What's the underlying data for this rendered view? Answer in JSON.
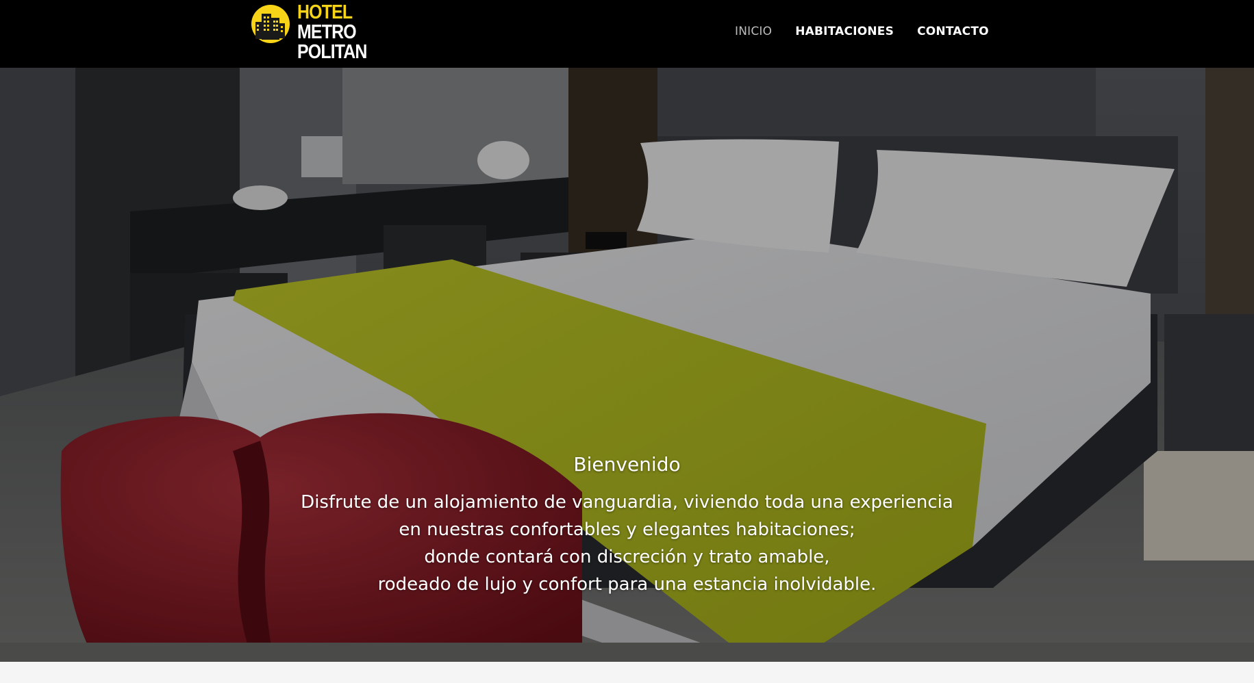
{
  "brand": {
    "logo_lines": [
      "HOTEL",
      "METRO",
      "POLITAN"
    ],
    "accent_color": "#f7d417",
    "icon": "building-emblem-icon"
  },
  "nav": {
    "items": [
      {
        "label": "INICIO",
        "active": true
      },
      {
        "label": "HABITACIONES",
        "active": false
      },
      {
        "label": "CONTACTO",
        "active": false
      }
    ]
  },
  "hero": {
    "title": "Bienvenido",
    "lines": [
      "Disfrute de un alojamiento de vanguardia, viviendo toda una experiencia",
      "en nuestras confortables y elegantes habitaciones;",
      "donde contará con discreción y trato amable,",
      "rodeado de lujo y confort para una estancia inolvidable."
    ],
    "image_subject": "hotel-room-bed-photo"
  },
  "colors": {
    "header_bg": "#000000",
    "nav_text": "#ffffff",
    "nav_active": "#bdbdbd",
    "runner": "#b9c41f",
    "ottoman": "#8e1b25"
  }
}
